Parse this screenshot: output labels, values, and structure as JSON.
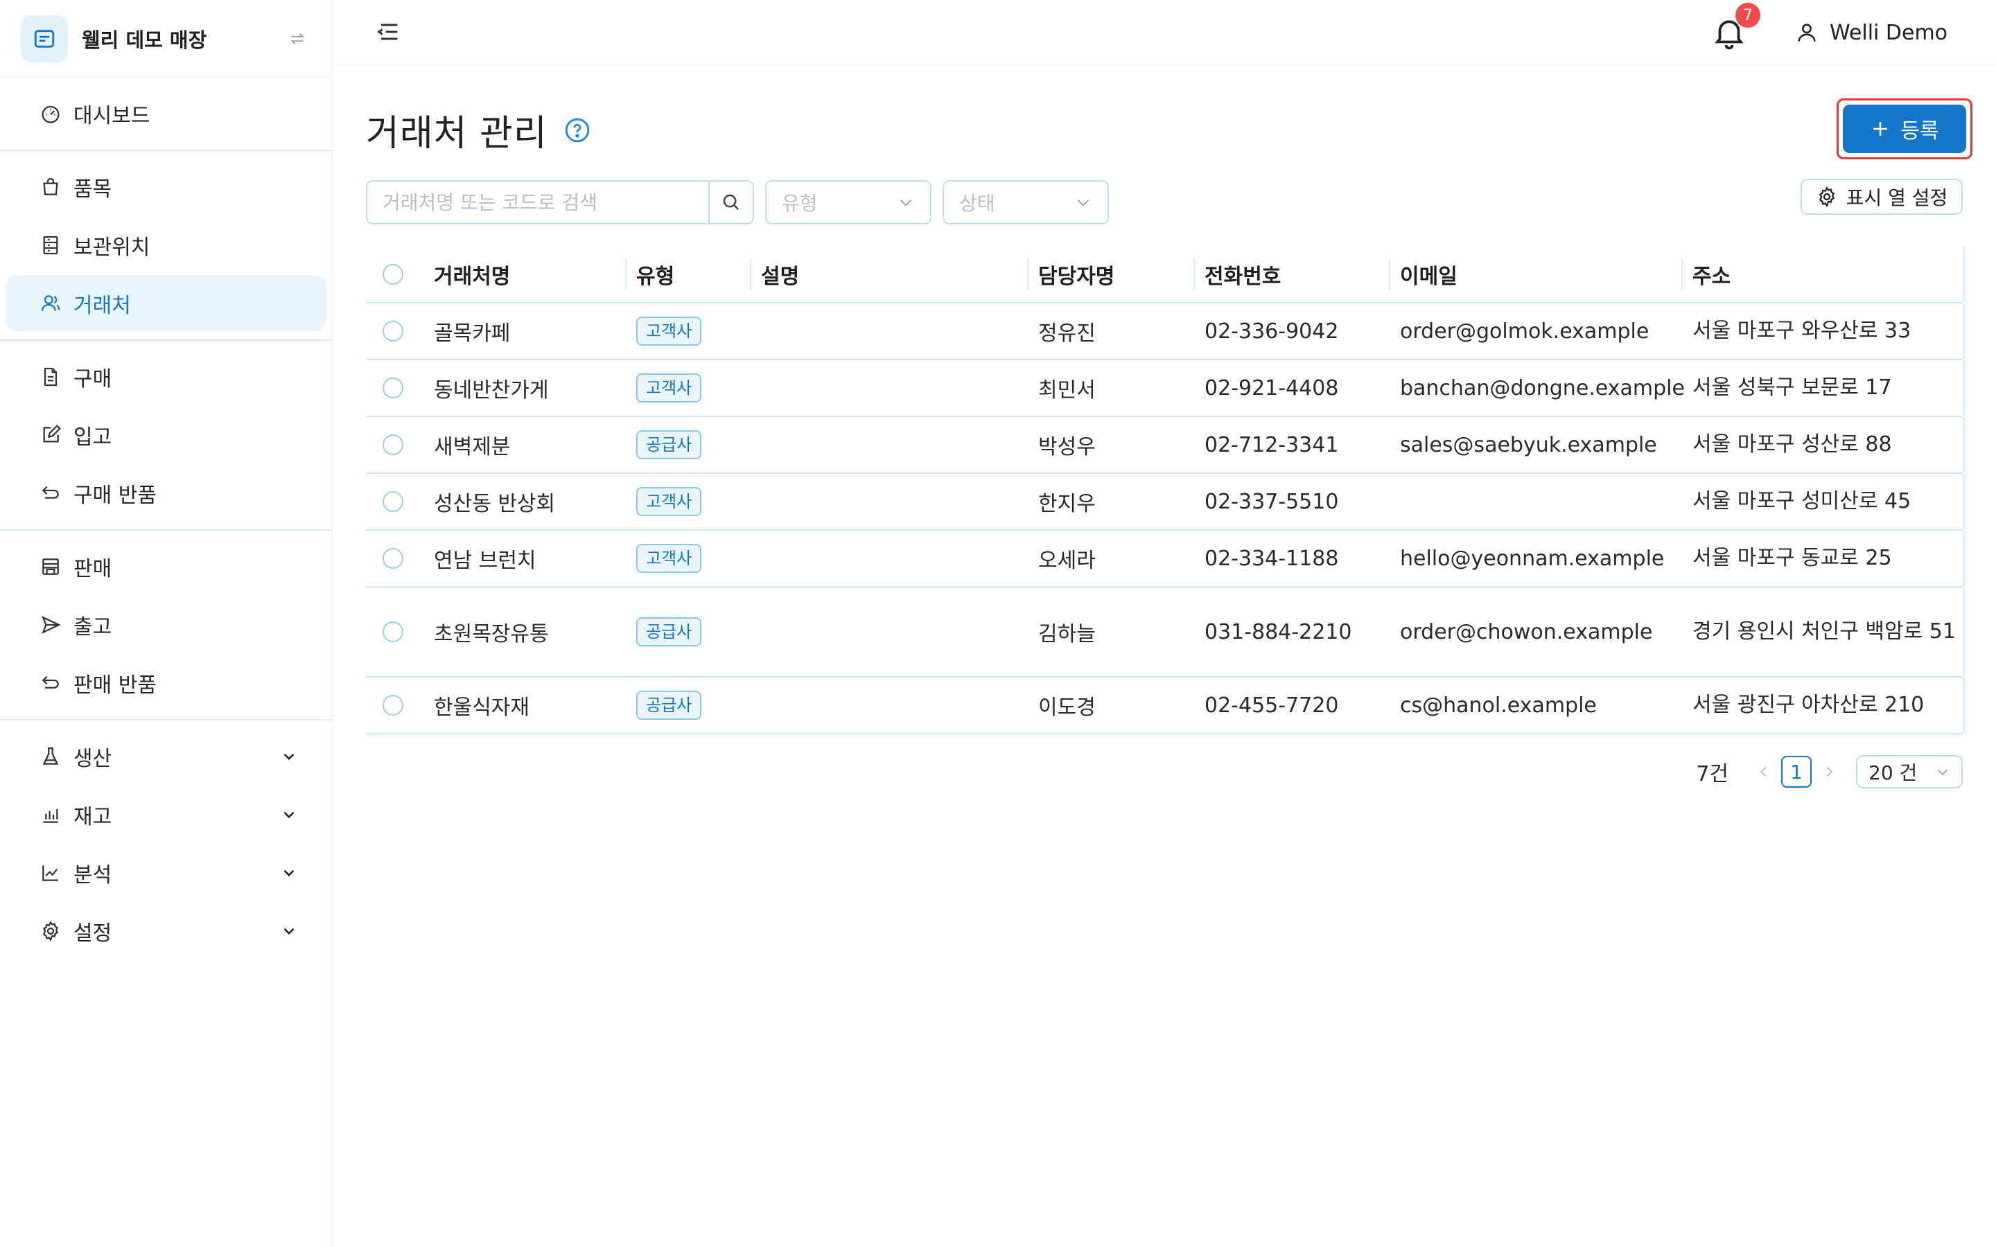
{
  "brand": {
    "name": "웰리 데모 매장"
  },
  "sidebar": {
    "groups": [
      [
        {
          "label": "대시보드",
          "icon": "dashboard-icon"
        }
      ],
      [
        {
          "label": "품목",
          "icon": "bag-icon"
        },
        {
          "label": "보관위치",
          "icon": "shelf-icon"
        },
        {
          "label": "거래처",
          "icon": "users-icon",
          "active": true
        }
      ],
      [
        {
          "label": "구매",
          "icon": "document-icon"
        },
        {
          "label": "입고",
          "icon": "edit-box-icon"
        },
        {
          "label": "구매 반품",
          "icon": "return-icon"
        }
      ],
      [
        {
          "label": "판매",
          "icon": "shop-icon"
        },
        {
          "label": "출고",
          "icon": "send-icon"
        },
        {
          "label": "판매 반품",
          "icon": "return-icon"
        }
      ],
      [
        {
          "label": "생산",
          "icon": "flask-icon",
          "expandable": true
        },
        {
          "label": "재고",
          "icon": "bar-chart-icon",
          "expandable": true
        },
        {
          "label": "분석",
          "icon": "line-chart-icon",
          "expandable": true
        },
        {
          "label": "설정",
          "icon": "gear-icon",
          "expandable": true
        }
      ]
    ]
  },
  "header": {
    "notifications": "7",
    "user": "Welli Demo"
  },
  "page": {
    "title": "거래처 관리",
    "register_label": "등록"
  },
  "filters": {
    "search_placeholder": "거래처명 또는 코드로 검색",
    "type_placeholder": "유형",
    "status_placeholder": "상태",
    "column_settings": "표시 열 설정"
  },
  "table": {
    "columns": [
      "거래처명",
      "유형",
      "설명",
      "담당자명",
      "전화번호",
      "이메일",
      "주소"
    ],
    "rows": [
      {
        "name": "골목카페",
        "type": "고객사",
        "desc": "",
        "manager": "정유진",
        "phone": "02-336-9042",
        "email": "order@golmok.example",
        "address": "서울 마포구 와우산로 33"
      },
      {
        "name": "동네반찬가게",
        "type": "고객사",
        "desc": "",
        "manager": "최민서",
        "phone": "02-921-4408",
        "email": "banchan@dongne.example",
        "address": "서울 성북구 보문로 17"
      },
      {
        "name": "새벽제분",
        "type": "공급사",
        "desc": "",
        "manager": "박성우",
        "phone": "02-712-3341",
        "email": "sales@saebyuk.example",
        "address": "서울 마포구 성산로 88"
      },
      {
        "name": "성산동 반상회",
        "type": "고객사",
        "desc": "",
        "manager": "한지우",
        "phone": "02-337-5510",
        "email": "",
        "address": "서울 마포구 성미산로 45"
      },
      {
        "name": "연남 브런치",
        "type": "고객사",
        "desc": "",
        "manager": "오세라",
        "phone": "02-334-1188",
        "email": "hello@yeonnam.example",
        "address": "서울 마포구 동교로 25"
      },
      {
        "name": "초원목장유통",
        "type": "공급사",
        "desc": "",
        "manager": "김하늘",
        "phone": "031-884-2210",
        "email": "order@chowon.example",
        "address": "경기 용인시 처인구 백암로 51",
        "tall": true
      },
      {
        "name": "한울식자재",
        "type": "공급사",
        "desc": "",
        "manager": "이도경",
        "phone": "02-455-7720",
        "email": "cs@hanol.example",
        "address": "서울 광진구 아차산로 210"
      }
    ]
  },
  "pagination": {
    "total": "7건",
    "current_page": "1",
    "page_size": "20 건"
  },
  "colors": {
    "accent": "#1577c9",
    "badge": "#ef4b4b",
    "border": "#bfe0f4"
  }
}
